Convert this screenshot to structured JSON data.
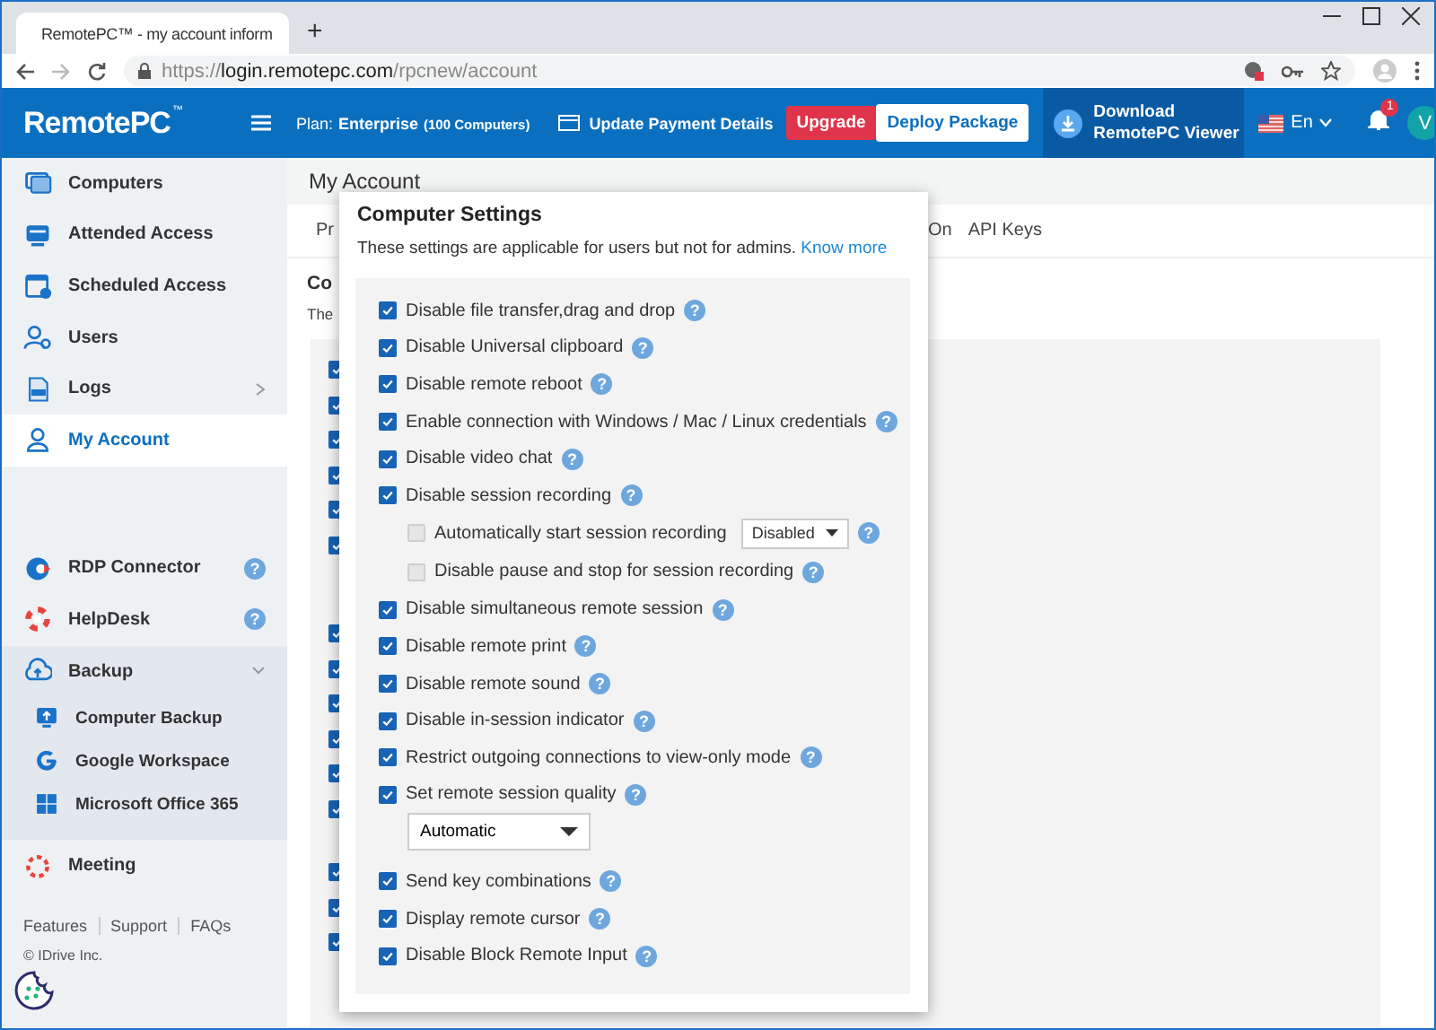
{
  "browser": {
    "tab_title": "RemotePC™ - my account inform",
    "new_tab": "+",
    "url": {
      "scheme": "https://",
      "host": "login.remotepc.com",
      "path": "/rpcnew/account"
    }
  },
  "header": {
    "logo": "RemotePC",
    "logo_mark": "™",
    "plan_label": "Plan:",
    "plan_name": "Enterprise",
    "plan_detail": "(100 Computers)",
    "payment": "Update Payment Details",
    "upgrade": "Upgrade",
    "deploy": "Deploy Package",
    "download": [
      "Download",
      "RemotePC Viewer"
    ],
    "language": "En",
    "notifications": "1",
    "avatar": "V"
  },
  "sidebar": {
    "primary": [
      {
        "label": "Computers",
        "selected": false,
        "kind": "item"
      },
      {
        "label": "Attended Access",
        "selected": false,
        "kind": "item"
      },
      {
        "label": "Scheduled Access",
        "selected": false,
        "kind": "item"
      },
      {
        "label": "Users",
        "selected": false,
        "kind": "item"
      },
      {
        "label": "Logs",
        "selected": false,
        "kind": "submenu"
      },
      {
        "label": "My Account",
        "selected": true,
        "kind": "item"
      }
    ],
    "secondary": [
      {
        "label": "RDP Connector",
        "selected": false,
        "kind": "help",
        "help": "?"
      },
      {
        "label": "HelpDesk",
        "selected": false,
        "kind": "help",
        "help": "?"
      },
      {
        "label": "Backup",
        "selected": false,
        "kind": "group",
        "expanded": true,
        "children": [
          {
            "label": "Computer Backup"
          },
          {
            "label": "Google Workspace"
          },
          {
            "label": "Microsoft Office 365"
          }
        ]
      },
      {
        "label": "Meeting",
        "selected": false,
        "kind": "item"
      }
    ],
    "footer_links": [
      "Features",
      "Support",
      "FAQs"
    ],
    "copyright": "© IDrive Inc."
  },
  "main": {
    "title": "My Account",
    "tabs": [
      "Pr",
      "On",
      "API Keys"
    ],
    "section_title": "Co",
    "section_text": "The",
    "checkbox_groups": [
      {
        "checkboxes": [
          {
            "checked": true
          },
          {
            "checked": true
          },
          {
            "checked": true
          },
          {
            "checked": true
          },
          {
            "checked": true
          },
          {
            "checked": true
          }
        ]
      },
      {
        "checkboxes": [
          {
            "checked": true
          },
          {
            "checked": true
          },
          {
            "checked": true
          },
          {
            "checked": true
          },
          {
            "checked": true
          },
          {
            "checked": true
          }
        ]
      },
      {
        "checkboxes": [
          {
            "checked": true
          },
          {
            "checked": true
          },
          {
            "checked": true
          }
        ]
      }
    ]
  },
  "dialog": {
    "title": "Computer Settings",
    "note": "These settings are applicable for users but not for admins.",
    "link": "Know more",
    "settings": [
      {
        "label": "Disable file transfer,drag and drop",
        "checked": true,
        "help": "?"
      },
      {
        "label": "Disable Universal clipboard",
        "checked": true,
        "help": "?"
      },
      {
        "label": "Disable remote reboot",
        "checked": true,
        "help": "?"
      },
      {
        "label": "Enable connection with Windows / Mac / Linux credentials",
        "checked": true,
        "help": "?"
      },
      {
        "label": "Disable video chat",
        "checked": true,
        "help": "?"
      },
      {
        "label": "Disable session recording",
        "checked": true,
        "help": "?",
        "children": [
          {
            "label": "Automatically start session recording",
            "checked": false,
            "dropdown": "Disabled",
            "help": "?"
          },
          {
            "label": "Disable pause and stop for session recording",
            "checked": false,
            "help": "?"
          }
        ]
      },
      {
        "label": "Disable simultaneous remote session",
        "checked": true,
        "help": "?"
      },
      {
        "label": "Disable remote print",
        "checked": true,
        "help": "?"
      },
      {
        "label": "Disable remote sound",
        "checked": true,
        "help": "?"
      },
      {
        "label": "Disable in-session indicator",
        "checked": true,
        "help": "?"
      },
      {
        "label": "Restrict outgoing connections to view-only mode",
        "checked": true,
        "help": "?"
      },
      {
        "label": "Set remote session quality",
        "checked": true,
        "help": "?",
        "dropdown": "Automatic"
      },
      {
        "label": "Send key combinations",
        "checked": true,
        "help": "?"
      },
      {
        "label": "Display remote cursor",
        "checked": true,
        "help": "?"
      },
      {
        "label": "Disable Block Remote Input",
        "checked": true,
        "help": "?"
      }
    ]
  }
}
